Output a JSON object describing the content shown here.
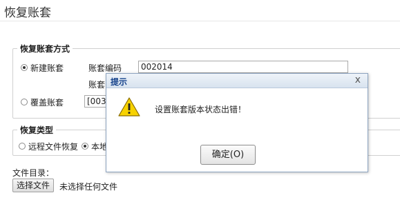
{
  "page": {
    "title": "恢复账套"
  },
  "restore_method": {
    "legend": "恢复账套方式",
    "new_option": "新建账套",
    "new_checked": true,
    "code_label": "账套编码",
    "code_value": "002014",
    "name_label_partial": "账套",
    "overwrite_option": "覆盖账套",
    "overwrite_checked": false,
    "overwrite_select_value": "[003]"
  },
  "restore_type": {
    "legend": "恢复类型",
    "remote_option": "远程文件恢复",
    "remote_checked": false,
    "local_option_partial": "本地",
    "local_checked": true
  },
  "file": {
    "dir_label": "文件目录：",
    "choose_button": "选择文件",
    "no_file_text": "未选择任何文件"
  },
  "dialog": {
    "title": "提示",
    "close_glyph": "x",
    "message": "设置账套版本状态出错！",
    "ok_button": "确定(O)",
    "icon": "warning-icon"
  }
}
